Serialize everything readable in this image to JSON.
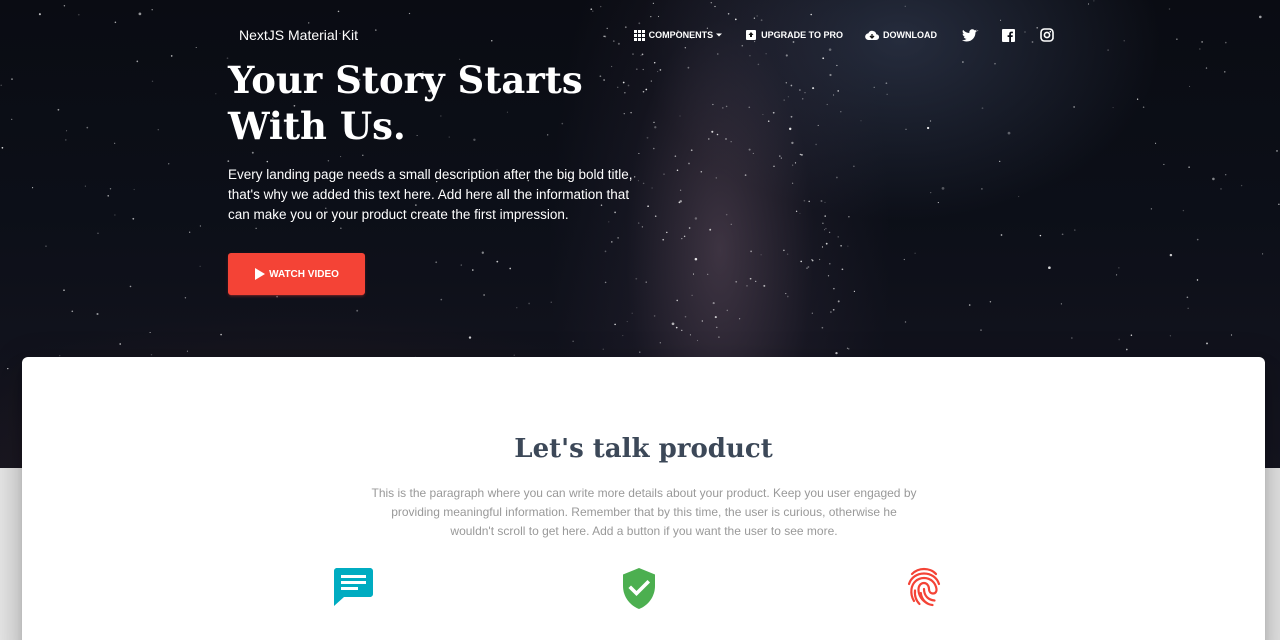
{
  "navbar": {
    "brand": "NextJS Material Kit",
    "items": [
      {
        "label": "Components",
        "icon": "apps-icon"
      },
      {
        "label": "Upgrade to pro",
        "icon": "unarchive-icon"
      },
      {
        "label": "Download",
        "icon": "cloud-download-icon"
      }
    ],
    "social": [
      "twitter-icon",
      "facebook-icon",
      "instagram-icon"
    ]
  },
  "hero": {
    "title": "Your Story Starts With Us.",
    "description": "Every landing page needs a small description after the big bold title, that's why we added this text here. Add here all the information that can make you or your product create the first impression.",
    "button_label": "Watch video"
  },
  "product_section": {
    "title": "Let's talk product",
    "description": "This is the paragraph where you can write more details about your product. Keep you user engaged by providing meaningful information. Remember that by this time, the user is curious, otherwise he wouldn't scroll to get here. Add a button if you want the user to see more.",
    "features": [
      {
        "icon": "chat-icon",
        "color": "#00acc1"
      },
      {
        "icon": "verified-user-icon",
        "color": "#4caf50"
      },
      {
        "icon": "fingerprint-icon",
        "color": "#f44336"
      }
    ]
  },
  "colors": {
    "primary_button": "#f44336",
    "heading": "#3c4858",
    "muted_text": "#999999"
  }
}
